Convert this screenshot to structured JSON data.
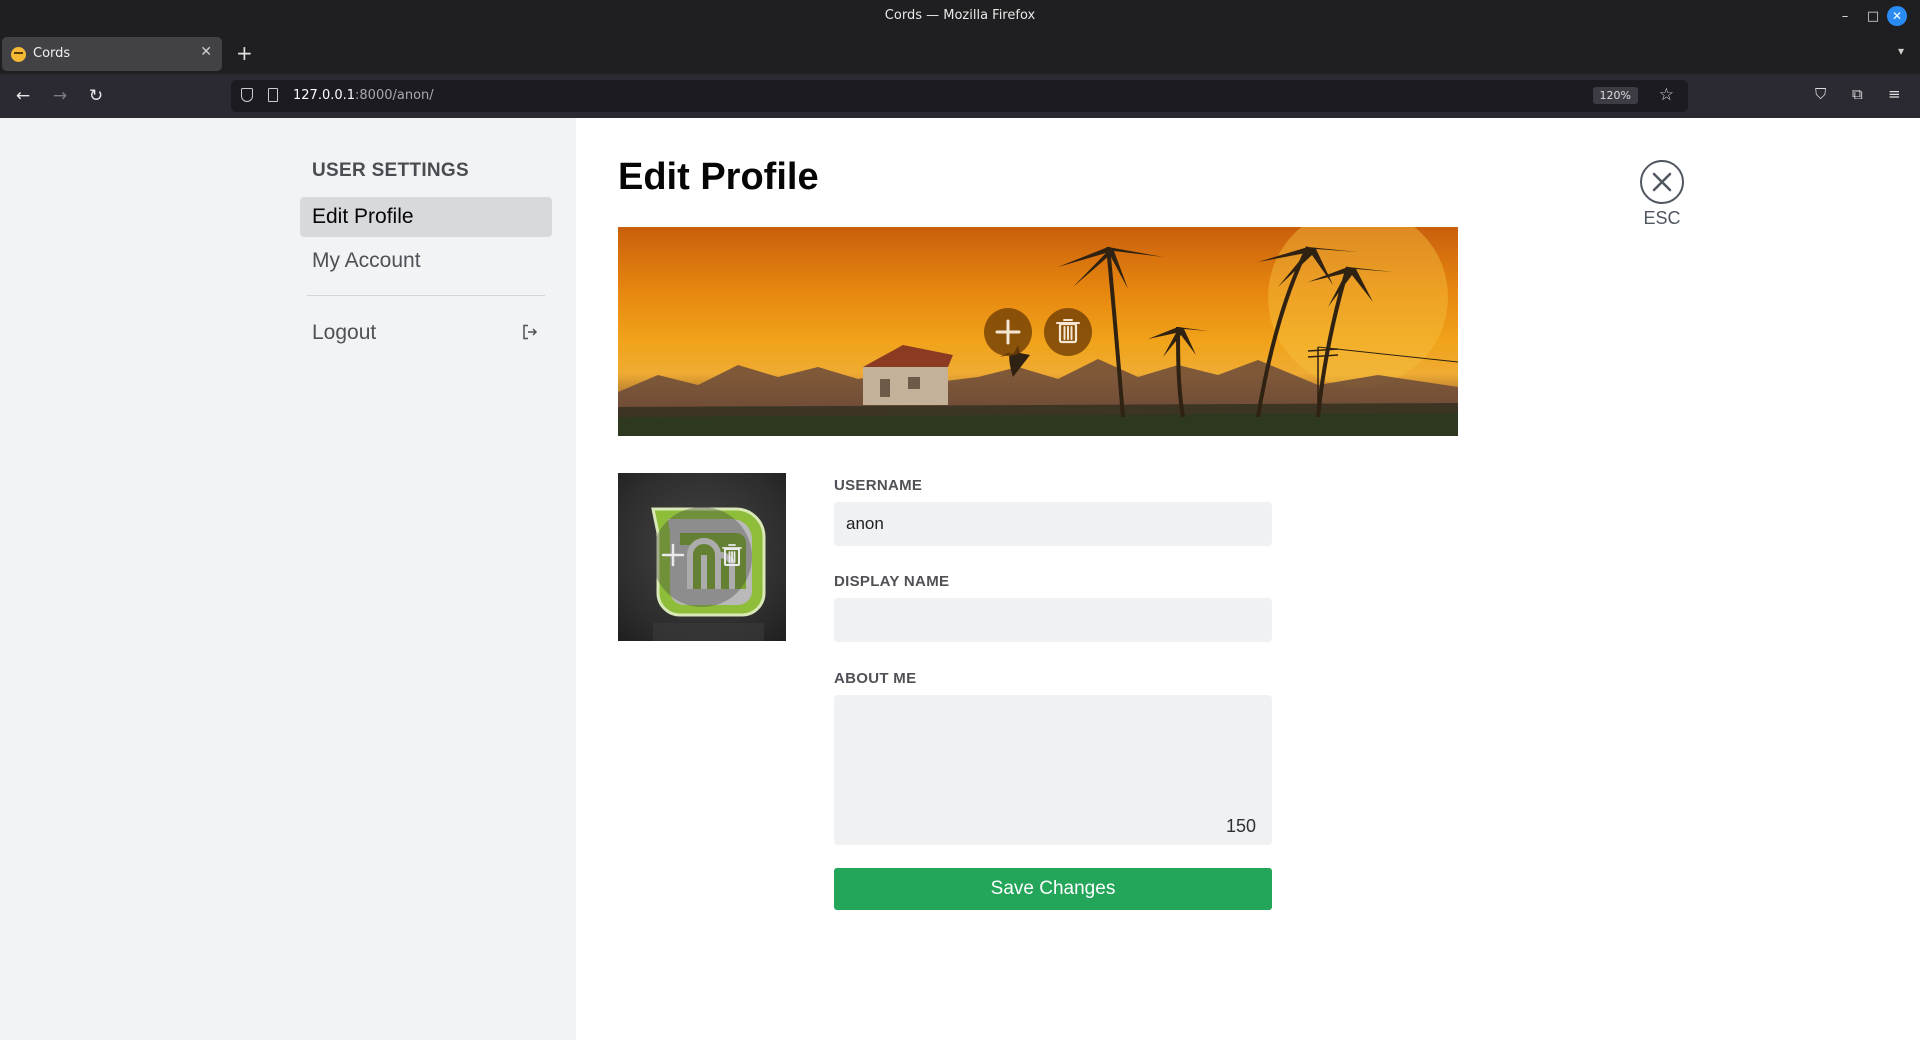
{
  "window": {
    "title": "Cords — Mozilla Firefox"
  },
  "browser": {
    "tab_title": "Cords",
    "url_host": "127.0.0.1",
    "url_rest": ":8000/anon/",
    "zoom": "120%"
  },
  "sidebar": {
    "heading": "USER SETTINGS",
    "items": [
      {
        "label": "Edit Profile",
        "active": true
      },
      {
        "label": "My Account",
        "active": false
      }
    ],
    "logout_label": "Logout"
  },
  "main": {
    "title": "Edit Profile",
    "esc_label": "ESC",
    "form": {
      "username_label": "USERNAME",
      "username_value": "anon",
      "display_name_label": "DISPLAY NAME",
      "display_name_value": "",
      "about_label": "ABOUT ME",
      "about_value": "",
      "char_count": "150",
      "save_label": "Save Changes"
    }
  },
  "icons": {
    "banner_add": "plus-icon",
    "banner_delete": "trash-icon",
    "avatar_add": "plus-icon",
    "avatar_delete": "trash-icon",
    "close": "close-circle-icon",
    "logout": "logout-icon"
  },
  "colors": {
    "save_button": "#23a55a",
    "sidebar_bg": "#f2f3f5",
    "active_item_bg": "#d8d9dc",
    "input_bg": "#f0f1f3"
  }
}
